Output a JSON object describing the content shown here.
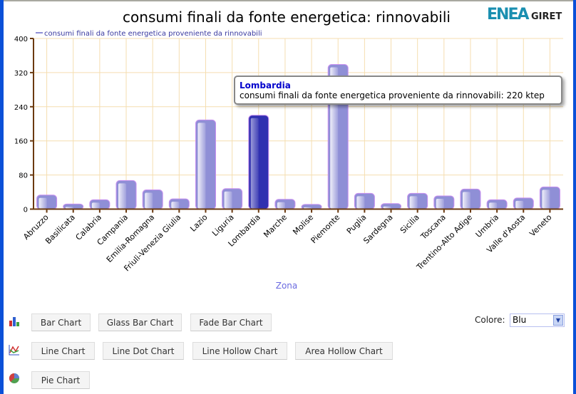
{
  "chart_data": {
    "type": "bar",
    "title": "consumi finali da fonte energetica: rinnovabili",
    "xlabel": "Zona",
    "ylabel": "",
    "ylim": [
      0,
      400
    ],
    "yticks": [
      0,
      80,
      160,
      240,
      320,
      400
    ],
    "grid": true,
    "legend_placement": "top-left",
    "categories": [
      "Abruzzo",
      "Basilicata",
      "Calabria",
      "Campania",
      "Emilia-Romagna",
      "Friuli-Venezia Giulia",
      "Lazio",
      "Liguria",
      "Lombardia",
      "Marche",
      "Molise",
      "Piemonte",
      "Puglia",
      "Sardegna",
      "Sicilia",
      "Toscana",
      "Trentino-Alto Adige",
      "Umbria",
      "Valle d'Aosta",
      "Veneto"
    ],
    "series": [
      {
        "name": "consumi finali da fonte energetica proveniente da rinnovabili",
        "values": [
          33,
          12,
          22,
          67,
          45,
          24,
          209,
          48,
          220,
          23,
          11,
          339,
          37,
          13,
          37,
          31,
          47,
          22,
          26,
          52
        ]
      }
    ],
    "highlighted": "Lombardia",
    "colors": {
      "bar": "#8f8fd6",
      "highlight": "#3030b0",
      "grid": "#f5deb0",
      "axis": "#6b3a10",
      "legend_text": "#3a3aa0",
      "xlabel": "#6a6ae0"
    }
  },
  "tooltip": {
    "title": "Lombardia",
    "body": "consumi finali da fonte energetica proveniente da rinnovabili: 220 ktep"
  },
  "logo": {
    "text": "ENEA GIRET"
  },
  "controls": {
    "bar_row": {
      "icon": "bar-chart-icon",
      "buttons": [
        "Bar Chart",
        "Glass Bar Chart",
        "Fade Bar Chart"
      ]
    },
    "line_row": {
      "icon": "line-chart-icon",
      "buttons": [
        "Line Chart",
        "Line Dot Chart",
        "Line Hollow Chart",
        "Area Hollow Chart"
      ]
    },
    "pie_row": {
      "icon": "pie-chart-icon",
      "buttons": [
        "Pie Chart"
      ]
    },
    "colore_label": "Colore:",
    "colore_value": "Blu"
  }
}
